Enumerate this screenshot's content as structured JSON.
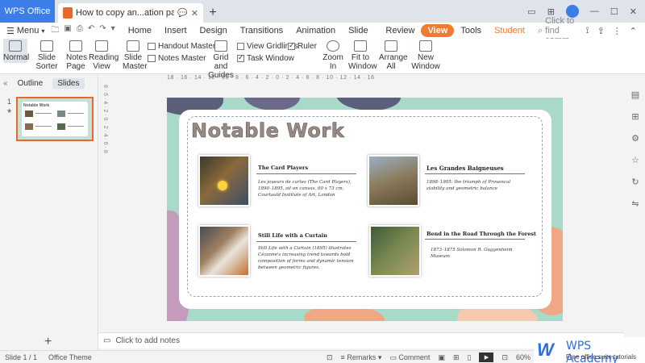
{
  "titlebar": {
    "app_tab": "WPS Office",
    "doc_tab": "How to copy an...ation painter",
    "new_tab": "+",
    "controls": [
      "▭",
      "⊞",
      "—",
      "☐",
      "✕"
    ]
  },
  "menu": {
    "menu_label": "Menu",
    "items": [
      "Home",
      "Insert",
      "Design",
      "Transitions",
      "Animation",
      "Slide Show",
      "Review",
      "View",
      "Tools",
      "Student Tools"
    ],
    "active": "View",
    "find_placeholder": "Click to find comm...",
    "right_icons": [
      "⟟",
      "⇪",
      "⋮",
      "⌃"
    ]
  },
  "ribbon": {
    "normal": "Normal",
    "slide_sorter": "Slide Sorter",
    "notes_page_1": "Notes",
    "notes_page_2": "Page",
    "reading_view_1": "Reading",
    "reading_view_2": "View",
    "slide_master_1": "Slide",
    "slide_master_2": "Master",
    "handout_master": "Handout Master",
    "notes_master": "Notes Master",
    "grid_guides_1": "Grid and",
    "grid_guides_2": "Guides",
    "view_gridlines": "View Gridlines",
    "ruler": "Ruler",
    "task_window": "Task Window",
    "zoom_in": "Zoom In",
    "fit_window_1": "Fit to",
    "fit_window_2": "Window",
    "arrange_all_1": "Arrange",
    "arrange_all_2": "All",
    "new_window": "New Window"
  },
  "leftpanel": {
    "outline_tab": "Outline",
    "slides_tab": "Slides",
    "slide_number": "1",
    "thumb_title": "Notable Work",
    "add_slide": "+"
  },
  "ruler_h": "18 · 16 · 14 · 12 · 10 · 8 · 6 · 4 · 2 · 0 · 2 · 4 · 6 · 8 · 10 · 12 · 14 · 16",
  "ruler_v": "8 · 6 · 4 · 2 · 0 · 2 · 4 · 6 · 8",
  "slide": {
    "title": "Notable Work",
    "items": [
      {
        "title": "The Card Players",
        "desc": "Les joueurs de cartes (The Card Players), 1890–1895, oil on canvas, 60 x 73 cm, Courtauld Institute of Art, London"
      },
      {
        "title": "Les Grandes Baigneuses",
        "desc": "1898–1905: the triumph of Provencal stability and geometric balance"
      },
      {
        "title": "Still Life with a Curtain",
        "desc": "Still Life with a Curtain (1895) illustrates Cézanne's increasing trend towards bold composition of forms and dynamic tension between geometric figures."
      },
      {
        "title": "Bend in the Road Through the Forest",
        "desc": "1873–1875 Solomon R. Guggenheim Museum"
      }
    ]
  },
  "notes": {
    "placeholder": "Click to add notes"
  },
  "status": {
    "slide_info": "Slide 1 / 1",
    "theme": "Office Theme",
    "remarks": "Remarks",
    "comment": "Comment",
    "zoom": "60%"
  },
  "watermark": {
    "title": "WPS Academy",
    "subtitle": "Free office suite tutorials"
  },
  "colors": {
    "accent": "#f07b32",
    "tab_blue": "#3c7de8",
    "slide_bg": "#a9d9c9"
  }
}
